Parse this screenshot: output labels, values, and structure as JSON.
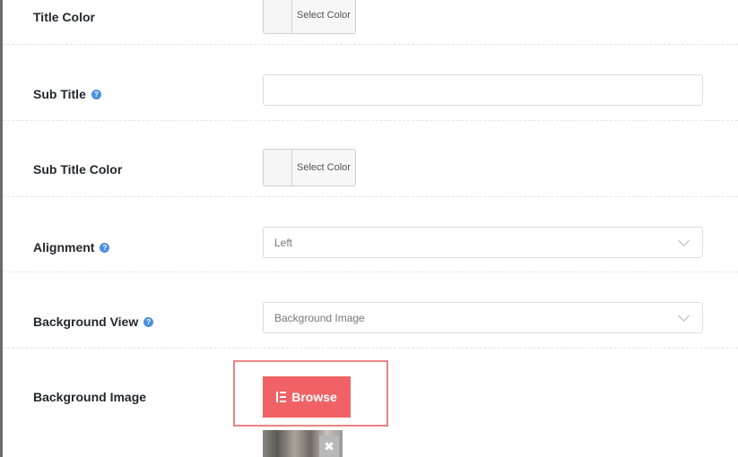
{
  "fields": {
    "title_color": {
      "label": "Title Color",
      "button": "Select Color"
    },
    "sub_title": {
      "label": "Sub Title",
      "help": "?",
      "value": ""
    },
    "sub_title_color": {
      "label": "Sub Title Color",
      "button": "Select Color"
    },
    "alignment": {
      "label": "Alignment",
      "help": "?",
      "selected": "Left"
    },
    "background_view": {
      "label": "Background View",
      "help": "?",
      "selected": "Background Image"
    },
    "background_image": {
      "label": "Background Image",
      "browse_label": "Browse",
      "remove_glyph": "✖"
    }
  },
  "colors": {
    "browse_bg": "#f06266",
    "highlight_border": "#e98484",
    "help_icon": "#4a90e2"
  },
  "icons": {
    "browse": "elementor-icon",
    "help": "question-circle-icon",
    "remove": "close-icon",
    "dropdown": "chevron-down-icon"
  }
}
